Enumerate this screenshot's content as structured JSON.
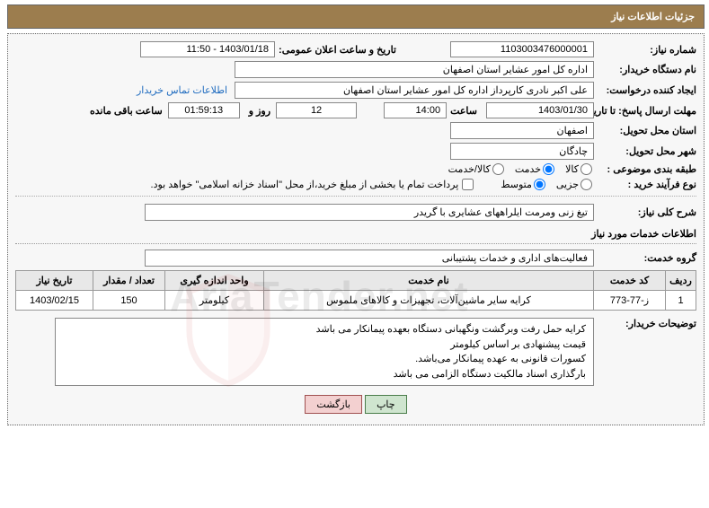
{
  "title": "جزئیات اطلاعات نیاز",
  "labels": {
    "need_no": "شماره نیاز:",
    "announce_dt": "تاریخ و ساعت اعلان عمومی:",
    "buyer_org": "نام دستگاه خریدار:",
    "requester": "ایجاد کننده درخواست:",
    "contact_link": "اطلاعات تماس خریدار",
    "deadline": "مهلت ارسال پاسخ: تا تاریخ:",
    "time": "ساعت",
    "days_and": "روز و",
    "time_left": "ساعت باقی مانده",
    "deliver_province": "استان محل تحویل:",
    "deliver_city": "شهر محل تحویل:",
    "category": "طبقه بندی موضوعی :",
    "cat_goods": "کالا",
    "cat_service": "خدمت",
    "cat_gs": "کالا/خدمت",
    "buy_type": "نوع فرآیند خرید :",
    "bt_partial": "جزیی",
    "bt_medium": "متوسط",
    "pay_note": "پرداخت تمام یا بخشی از مبلغ خرید،از محل \"اسناد خزانه اسلامی\" خواهد بود.",
    "need_desc": "شرح کلی نیاز:",
    "svc_info": "اطلاعات خدمات مورد نیاز",
    "svc_group": "گروه خدمت:",
    "buyer_notes": "توضیحات خریدار:",
    "print": "چاپ",
    "back": "بازگشت"
  },
  "values": {
    "need_no": "1103003476000001",
    "announce_dt": "1403/01/18 - 11:50",
    "buyer_org": "اداره کل امور عشایر استان اصفهان",
    "requester": "علی اکبر نادری کارپرداز اداره کل امور عشایر استان اصفهان",
    "deadline_date": "1403/01/30",
    "deadline_time": "14:00",
    "days_left": "12",
    "countdown": "01:59:13",
    "province": "اصفهان",
    "city": "چادگان",
    "need_desc": "تیغ زنی ومرمت ایلراههای عشایری با گریدر",
    "svc_group": "فعالیت‌های اداری و خدمات پشتیبانی",
    "buyer_notes": [
      "کرایه حمل رفت وبرگشت ونگهبانی دستگاه بعهده پیمانکار می باشد",
      "قیمت پیشنهادی بر اساس کیلومتر",
      "کسورات قانونی به عهده پیمانکار می‌باشد.",
      "بارگذاری اسناد مالکیت دستگاه الزامی می باشد"
    ]
  },
  "table": {
    "headers": [
      "ردیف",
      "کد خدمت",
      "نام خدمت",
      "واحد اندازه گیری",
      "تعداد / مقدار",
      "تاریخ نیاز"
    ],
    "rows": [
      [
        "1",
        "ز-77-773",
        "کرایه سایر ماشین‌آلات، تجهیزات و کالاهای ملموس",
        "کیلومتر",
        "150",
        "1403/02/15"
      ]
    ]
  },
  "watermark": "AriaTender.net"
}
